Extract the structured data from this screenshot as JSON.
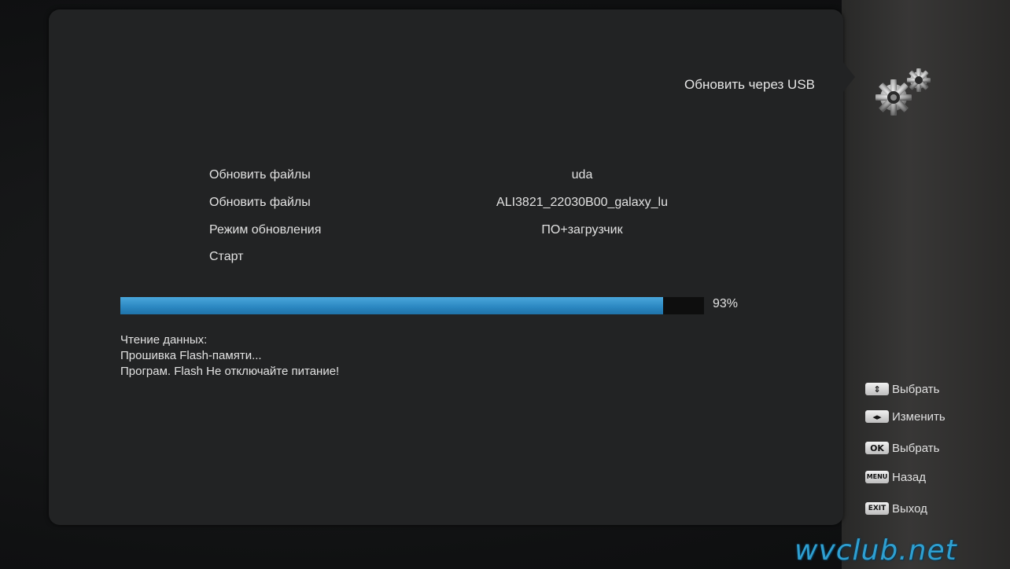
{
  "menu": {
    "title": "Обновить через USB"
  },
  "settings": {
    "rows": [
      {
        "label": "Обновить файлы",
        "value": "uda"
      },
      {
        "label": "Обновить файлы",
        "value": "ALI3821_22030B00_galaxy_lu"
      },
      {
        "label": "Режим обновления",
        "value": "ПО+загрузчик"
      },
      {
        "label": "Старт",
        "value": ""
      }
    ]
  },
  "progress": {
    "value": 0.93,
    "label": "93%"
  },
  "status_lines": [
    "Чтение данных:",
    "Прошивка Flash-памяти...",
    "Програм. Flash Не отключайте питание!"
  ],
  "hints": [
    {
      "key_icon": "up-down-keys-icon",
      "key_text": "⇕",
      "label": "Выбрать"
    },
    {
      "key_icon": "left-right-keys-icon",
      "key_text": "◂▸",
      "label": "Изменить"
    },
    {
      "key_icon": "ok-key-icon",
      "key_text": "OK",
      "label": "Выбрать"
    },
    {
      "key_icon": "menu-key-icon",
      "key_text": "MENU",
      "label": "Назад"
    },
    {
      "key_icon": "exit-key-icon",
      "key_text": "EXIT",
      "label": "Выход"
    }
  ],
  "watermark": "wvclub.net",
  "colors": {
    "progress_fill": "#2f93cf",
    "progress_track": "#0e0e0e",
    "panel": "#222324",
    "watermark": "#2f9fd0"
  },
  "icons": {
    "settings": "gears-icon"
  }
}
